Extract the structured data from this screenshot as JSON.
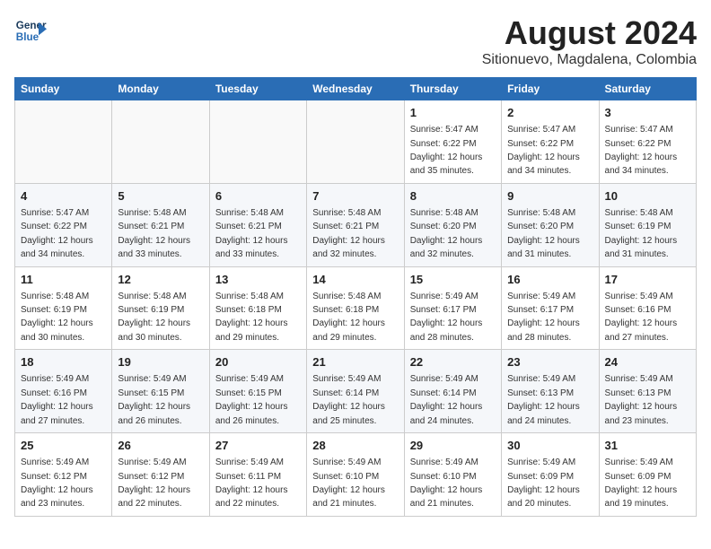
{
  "logo": {
    "line1": "General",
    "line2": "Blue"
  },
  "title": "August 2024",
  "subtitle": "Sitionuevo, Magdalena, Colombia",
  "days_of_week": [
    "Sunday",
    "Monday",
    "Tuesday",
    "Wednesday",
    "Thursday",
    "Friday",
    "Saturday"
  ],
  "weeks": [
    [
      {
        "day": "",
        "info": ""
      },
      {
        "day": "",
        "info": ""
      },
      {
        "day": "",
        "info": ""
      },
      {
        "day": "",
        "info": ""
      },
      {
        "day": "1",
        "info": "Sunrise: 5:47 AM\nSunset: 6:22 PM\nDaylight: 12 hours\nand 35 minutes."
      },
      {
        "day": "2",
        "info": "Sunrise: 5:47 AM\nSunset: 6:22 PM\nDaylight: 12 hours\nand 34 minutes."
      },
      {
        "day": "3",
        "info": "Sunrise: 5:47 AM\nSunset: 6:22 PM\nDaylight: 12 hours\nand 34 minutes."
      }
    ],
    [
      {
        "day": "4",
        "info": "Sunrise: 5:47 AM\nSunset: 6:22 PM\nDaylight: 12 hours\nand 34 minutes."
      },
      {
        "day": "5",
        "info": "Sunrise: 5:48 AM\nSunset: 6:21 PM\nDaylight: 12 hours\nand 33 minutes."
      },
      {
        "day": "6",
        "info": "Sunrise: 5:48 AM\nSunset: 6:21 PM\nDaylight: 12 hours\nand 33 minutes."
      },
      {
        "day": "7",
        "info": "Sunrise: 5:48 AM\nSunset: 6:21 PM\nDaylight: 12 hours\nand 32 minutes."
      },
      {
        "day": "8",
        "info": "Sunrise: 5:48 AM\nSunset: 6:20 PM\nDaylight: 12 hours\nand 32 minutes."
      },
      {
        "day": "9",
        "info": "Sunrise: 5:48 AM\nSunset: 6:20 PM\nDaylight: 12 hours\nand 31 minutes."
      },
      {
        "day": "10",
        "info": "Sunrise: 5:48 AM\nSunset: 6:19 PM\nDaylight: 12 hours\nand 31 minutes."
      }
    ],
    [
      {
        "day": "11",
        "info": "Sunrise: 5:48 AM\nSunset: 6:19 PM\nDaylight: 12 hours\nand 30 minutes."
      },
      {
        "day": "12",
        "info": "Sunrise: 5:48 AM\nSunset: 6:19 PM\nDaylight: 12 hours\nand 30 minutes."
      },
      {
        "day": "13",
        "info": "Sunrise: 5:48 AM\nSunset: 6:18 PM\nDaylight: 12 hours\nand 29 minutes."
      },
      {
        "day": "14",
        "info": "Sunrise: 5:48 AM\nSunset: 6:18 PM\nDaylight: 12 hours\nand 29 minutes."
      },
      {
        "day": "15",
        "info": "Sunrise: 5:49 AM\nSunset: 6:17 PM\nDaylight: 12 hours\nand 28 minutes."
      },
      {
        "day": "16",
        "info": "Sunrise: 5:49 AM\nSunset: 6:17 PM\nDaylight: 12 hours\nand 28 minutes."
      },
      {
        "day": "17",
        "info": "Sunrise: 5:49 AM\nSunset: 6:16 PM\nDaylight: 12 hours\nand 27 minutes."
      }
    ],
    [
      {
        "day": "18",
        "info": "Sunrise: 5:49 AM\nSunset: 6:16 PM\nDaylight: 12 hours\nand 27 minutes."
      },
      {
        "day": "19",
        "info": "Sunrise: 5:49 AM\nSunset: 6:15 PM\nDaylight: 12 hours\nand 26 minutes."
      },
      {
        "day": "20",
        "info": "Sunrise: 5:49 AM\nSunset: 6:15 PM\nDaylight: 12 hours\nand 26 minutes."
      },
      {
        "day": "21",
        "info": "Sunrise: 5:49 AM\nSunset: 6:14 PM\nDaylight: 12 hours\nand 25 minutes."
      },
      {
        "day": "22",
        "info": "Sunrise: 5:49 AM\nSunset: 6:14 PM\nDaylight: 12 hours\nand 24 minutes."
      },
      {
        "day": "23",
        "info": "Sunrise: 5:49 AM\nSunset: 6:13 PM\nDaylight: 12 hours\nand 24 minutes."
      },
      {
        "day": "24",
        "info": "Sunrise: 5:49 AM\nSunset: 6:13 PM\nDaylight: 12 hours\nand 23 minutes."
      }
    ],
    [
      {
        "day": "25",
        "info": "Sunrise: 5:49 AM\nSunset: 6:12 PM\nDaylight: 12 hours\nand 23 minutes."
      },
      {
        "day": "26",
        "info": "Sunrise: 5:49 AM\nSunset: 6:12 PM\nDaylight: 12 hours\nand 22 minutes."
      },
      {
        "day": "27",
        "info": "Sunrise: 5:49 AM\nSunset: 6:11 PM\nDaylight: 12 hours\nand 22 minutes."
      },
      {
        "day": "28",
        "info": "Sunrise: 5:49 AM\nSunset: 6:10 PM\nDaylight: 12 hours\nand 21 minutes."
      },
      {
        "day": "29",
        "info": "Sunrise: 5:49 AM\nSunset: 6:10 PM\nDaylight: 12 hours\nand 21 minutes."
      },
      {
        "day": "30",
        "info": "Sunrise: 5:49 AM\nSunset: 6:09 PM\nDaylight: 12 hours\nand 20 minutes."
      },
      {
        "day": "31",
        "info": "Sunrise: 5:49 AM\nSunset: 6:09 PM\nDaylight: 12 hours\nand 19 minutes."
      }
    ]
  ]
}
